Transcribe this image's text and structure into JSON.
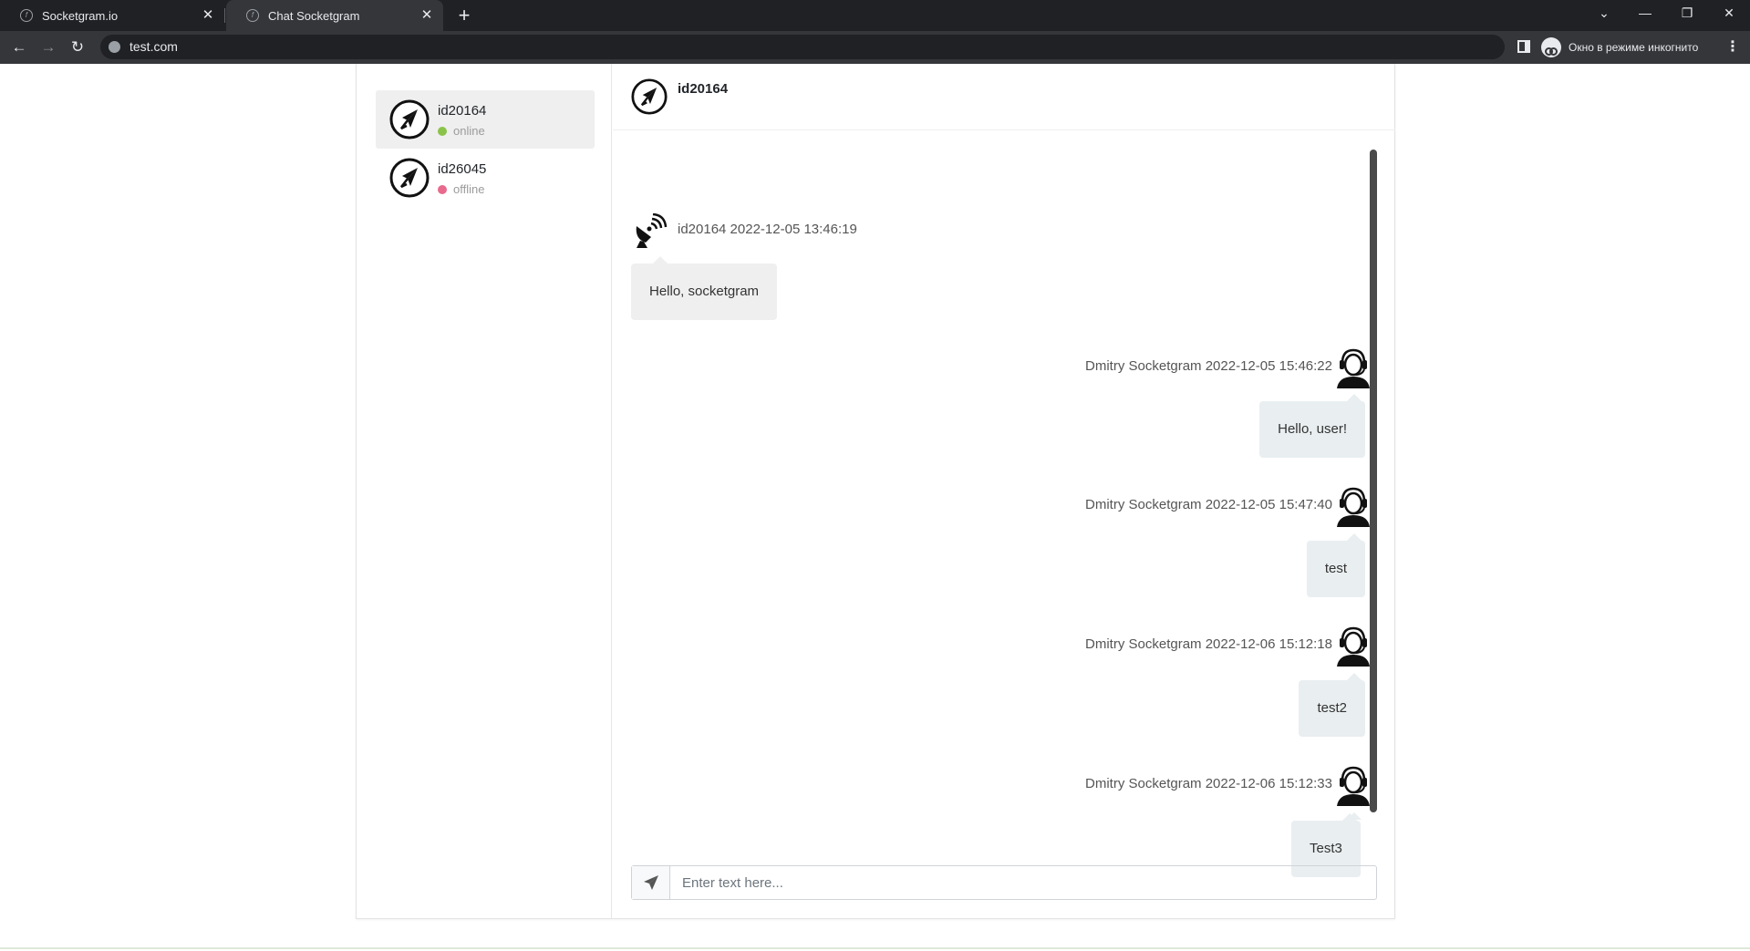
{
  "browser": {
    "tabs": [
      {
        "title": "Socketgram.io",
        "active": false
      },
      {
        "title": "Chat Socketgram",
        "active": true
      }
    ],
    "url": "test.com",
    "profile_label": "Окно в режиме инкогнито"
  },
  "sidebar": {
    "contacts": [
      {
        "name": "id20164",
        "status": "online",
        "status_color": "#8bc34a",
        "active": true
      },
      {
        "name": "id26045",
        "status": "offline",
        "status_color": "#e86a8d",
        "active": false
      }
    ]
  },
  "chat": {
    "header_name": "id20164",
    "messages": [
      {
        "direction": "in",
        "meta": "id20164 2022-12-05 13:46:19",
        "text": "Hello, socketgram",
        "icon": "satellite-dish-icon"
      },
      {
        "direction": "out",
        "meta": "Dmitry Socketgram 2022-12-05 15:46:22",
        "text": "Hello, user!",
        "icon": "support-agent-icon"
      },
      {
        "direction": "out",
        "meta": "Dmitry Socketgram 2022-12-05 15:47:40",
        "text": "test",
        "icon": "support-agent-icon"
      },
      {
        "direction": "out",
        "meta": "Dmitry Socketgram 2022-12-06 15:12:18",
        "text": "test2",
        "icon": "support-agent-icon"
      },
      {
        "direction": "out",
        "meta": "Dmitry Socketgram 2022-12-06 15:12:33",
        "text": "Test3",
        "icon": "support-agent-icon"
      }
    ],
    "input_placeholder": "Enter text here..."
  },
  "colors": {
    "chrome_dark": "#202124",
    "chrome_toolbar": "#35363a",
    "bubble_in": "#efefef",
    "bubble_out": "#e9eef0"
  }
}
